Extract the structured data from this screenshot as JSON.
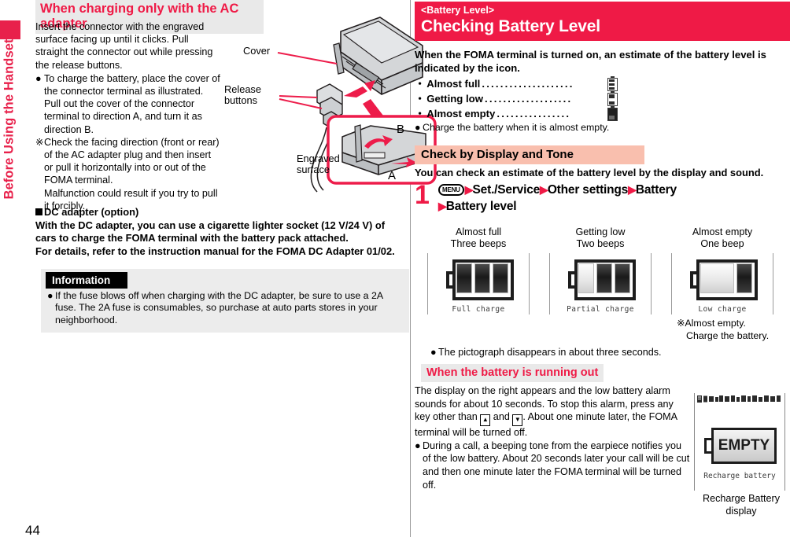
{
  "page": {
    "number": "44",
    "chapter_tab": "Before Using the Handset",
    "accent_red": "#ef1a46",
    "header_gray": "#e9e9e9",
    "header_pink": "#f9bfae",
    "info_gray": "#ececec"
  },
  "left_column": {
    "section_heading": "When charging only with the AC adapter",
    "lead_paragraph": "Insert the connector with the engraved surface facing up until it clicks. Pull straight the connector out while pressing the release buttons.",
    "bullet_1_marker": "●",
    "bullet_1": "To charge the battery, place the cover of the connector terminal as illustrated. Pull out the cover of the connector terminal to direction A, and turn it as direction B.",
    "note_marker": "※",
    "note_1": "Check the facing direction (front or rear) of the AC adapter plug and then insert or pull it horizontally into or out of the FOMA terminal.",
    "note_1b": "Malfunction could result if you try to pull it forcibly.",
    "illustration": {
      "label_cover": "Cover",
      "label_release": "Release",
      "label_release2": "buttons",
      "label_engraved": "Engraved",
      "label_engraved2": "surface",
      "label_a": "A",
      "label_b": "B"
    },
    "dc_adapter": {
      "heading": "DC adapter (option)",
      "line_1": "With the DC adapter, you can use a cigarette lighter socket (12 V/24 V) of cars to charge the FOMA terminal with the battery pack attached.",
      "line_2": "For details, refer to the instruction manual for the FOMA DC Adapter 01/02."
    },
    "information_box": {
      "title": "Information",
      "bullet_marker": "●",
      "text": "If the fuse blows off when charging with the DC adapter, be sure to use a 2A fuse. The 2A fuse is consumables, so purchase at auto parts stores in your neighborhood."
    }
  },
  "right_column": {
    "banner": {
      "sub_title": "<Battery Level>",
      "title": "Checking Battery Level"
    },
    "intro": "When the FOMA terminal is turned on, an estimate of the battery level is indicated by the icon.",
    "levels": [
      {
        "bullet": "・",
        "name": "Almost full",
        "dots": "....................",
        "icon": "battery-full-icon",
        "segments": 3
      },
      {
        "bullet": "・",
        "name": "Getting low",
        "dots": "...................",
        "icon": "battery-half-icon",
        "segments": 2
      },
      {
        "bullet": "・",
        "name": "Almost empty",
        "dots": "................",
        "icon": "battery-empty-icon",
        "segments": 1
      }
    ],
    "levels_note_marker": "●",
    "levels_note": "Charge the battery when it is almost empty.",
    "tone_section": {
      "heading": "Check by Display and Tone",
      "intro": "You can check an estimate of the battery level by the display and sound.",
      "step_number": "1",
      "menu_key": "MENU",
      "step_part_1": "Set./Service",
      "step_part_2": "Other settings",
      "step_part_3": "Battery",
      "step_part_4": "Battery level",
      "arrow": "▶"
    },
    "battery_samples": [
      {
        "title": "Almost full",
        "beeps": "Three beeps",
        "caption": "Full charge",
        "filled": 3
      },
      {
        "title": "Getting low",
        "beeps": "Two beeps",
        "caption": "Partial charge",
        "filled": 2
      },
      {
        "title": "Almost empty",
        "beeps": "One beep",
        "caption": "Low charge",
        "filled": 1
      }
    ],
    "empty_note_marker": "※",
    "empty_note_1": "Almost empty.",
    "empty_note_2": "Charge the battery.",
    "pictograph_note_marker": "●",
    "pictograph_note": "The pictograph disappears in about three seconds.",
    "running_out": {
      "heading": "When the battery is running out",
      "para_part_a": "The display on the right appears and the low battery alarm sounds for about 10 seconds. To stop this alarm, press any key other than ",
      "key_up": "▲",
      "para_part_b": " and ",
      "key_down": "▼",
      "para_part_c": ". About one minute later, the FOMA terminal will be turned off.",
      "bullet_marker": "●",
      "bullet_text": "During a call, a beeping tone from the earpiece notifies you of the low battery. About 20 seconds later your call will be cut and then one minute later the FOMA terminal will be turned off.",
      "mock": {
        "screen_text": "EMPTY",
        "screen_caption": "Recharge battery",
        "figure_caption_1": "Recharge Battery",
        "figure_caption_2": "display"
      }
    }
  }
}
